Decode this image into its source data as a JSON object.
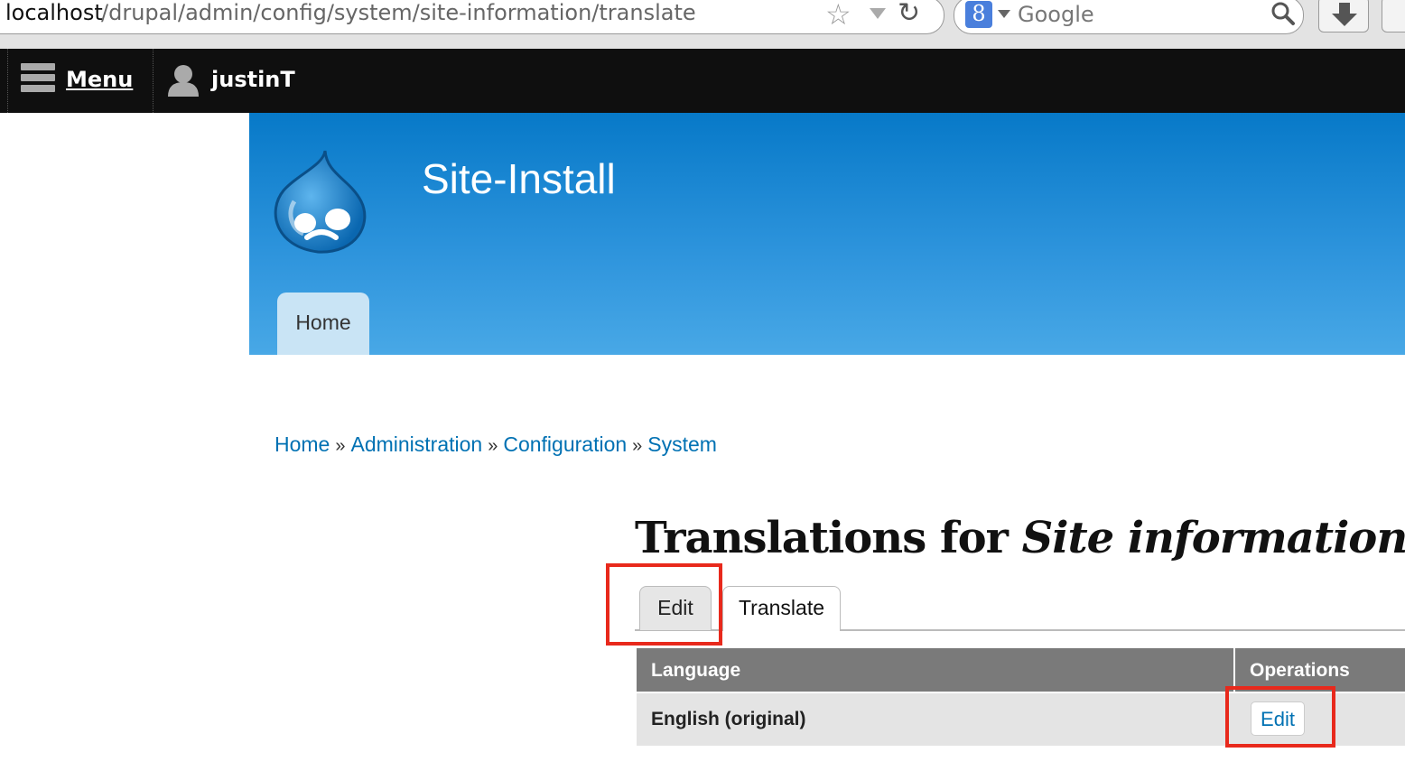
{
  "browser": {
    "url_host": "localhost",
    "url_path": "/drupal/admin/config/system/site-information/translate",
    "search_engine": "Google",
    "google_g": "8",
    "icons": [
      "star-icon",
      "dropdown-arrow-icon",
      "reload-icon",
      "google-g-icon",
      "search-magnifier-icon",
      "download-icon"
    ]
  },
  "toolbar": {
    "menu_label": "Menu",
    "user_label": "justinT",
    "icons": [
      "hamburger-icon",
      "user-icon"
    ]
  },
  "header": {
    "site_name": "Site-Install",
    "home_tab": "Home",
    "colors": {
      "top": "#0779c8",
      "bottom": "#48a8e6",
      "tab": "#c9e4f5"
    }
  },
  "breadcrumb": {
    "items": [
      "Home",
      "Administration",
      "Configuration",
      "System"
    ],
    "separator": "»"
  },
  "page": {
    "title_prefix": "Translations for ",
    "title_em": "Site information",
    "tabs": [
      {
        "label": "Edit",
        "active": false
      },
      {
        "label": "Translate",
        "active": true
      }
    ]
  },
  "table": {
    "headers": [
      "Language",
      "Operations"
    ],
    "rows": [
      {
        "language": "English (original)",
        "operation": "Edit"
      }
    ]
  },
  "annotations": {
    "highlight_color": "#e8291c"
  }
}
